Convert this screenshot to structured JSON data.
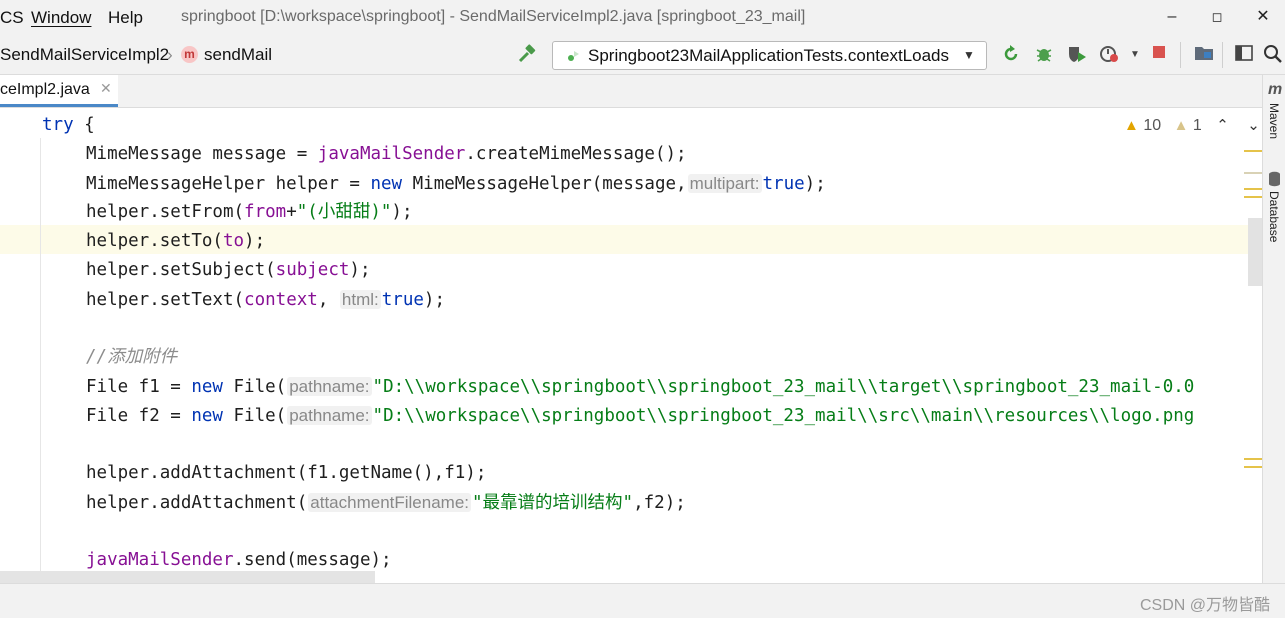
{
  "menu": {
    "partial": "CS",
    "window": "Window",
    "help": "Help"
  },
  "window_title": "springboot [D:\\workspace\\springboot] - SendMailServiceImpl2.java [springboot_23_mail]",
  "window_controls": {
    "minimize": "–",
    "maximize": "◻",
    "close": "✕"
  },
  "breadcrumb": {
    "class_name": "SendMailServiceImpl2",
    "separator": "›",
    "method_badge": "m",
    "method_name": "sendMail"
  },
  "run_config": {
    "label": "Springboot23MailApplicationTests.contextLoads",
    "arrow": "▼"
  },
  "toolbar_icons": [
    "hammer-icon",
    "rerun-icon",
    "debug-icon",
    "coverage-icon",
    "profile-icon",
    "stop-icon",
    "project-structure-icon",
    "layout-icon",
    "search-icon"
  ],
  "tab": {
    "label": "ceImpl2.java",
    "close": "✕"
  },
  "right_tools": {
    "maven": "Maven",
    "maven_glyph": "m",
    "database": "Database"
  },
  "problems": {
    "errors": "10",
    "warnings": "1",
    "up": "⌃",
    "down": "⌄"
  },
  "code": {
    "l1_kw": "try",
    "l1_rest": " {",
    "l2_a": "MimeMessage message = ",
    "l2_field": "javaMailSender",
    "l2_b": ".createMimeMessage();",
    "l3_a": "MimeMessageHelper helper = ",
    "l3_kw": "new",
    "l3_b": " MimeMessageHelper(message,",
    "l3_hint": "multipart:",
    "l3_kw2": "true",
    "l3_c": ");",
    "l4_a": "helper.setFrom(",
    "l4_field": "from",
    "l4_b": "+",
    "l4_str": "\"(小甜甜)\"",
    "l4_c": ");",
    "l5_a": "helper.setTo(",
    "l5_field": "to",
    "l5_b": ");",
    "l6_a": "helper.setSubject(",
    "l6_field": "subject",
    "l6_b": ");",
    "l7_a": "helper.setText(",
    "l7_field": "context",
    "l7_b": ",",
    "l7_hint": "html:",
    "l7_kw": "true",
    "l7_c": ");",
    "l9_comment": "//添加附件",
    "l10_a": "File f1 = ",
    "l10_kw": "new",
    "l10_b": " File(",
    "l10_hint": "pathname:",
    "l10_str": "\"D:\\\\workspace\\\\springboot\\\\springboot_23_mail\\\\target\\\\springboot_23_mail-0.0",
    "l11_a": "File f2 = ",
    "l11_kw": "new",
    "l11_b": " File(",
    "l11_hint": "pathname:",
    "l11_str": "\"D:\\\\workspace\\\\springboot\\\\springboot_23_mail\\\\src\\\\main\\\\resources\\\\logo.png",
    "l13": "helper.addAttachment(f1.getName(),f1);",
    "l14_a": "helper.addAttachment(",
    "l14_hint": "attachmentFilename:",
    "l14_str": "\"最靠谱的培训结构\"",
    "l14_b": ",f2);",
    "l16_field": "javaMailSender",
    "l16_b": ".send(message);"
  },
  "watermark": "CSDN @万物皆酷",
  "colors": {
    "keyword": "#0033b3",
    "field": "#871094",
    "string": "#067d17",
    "comment": "#8c8c8c",
    "current_line": "#fdfbe8",
    "warning": "#e2a400"
  }
}
